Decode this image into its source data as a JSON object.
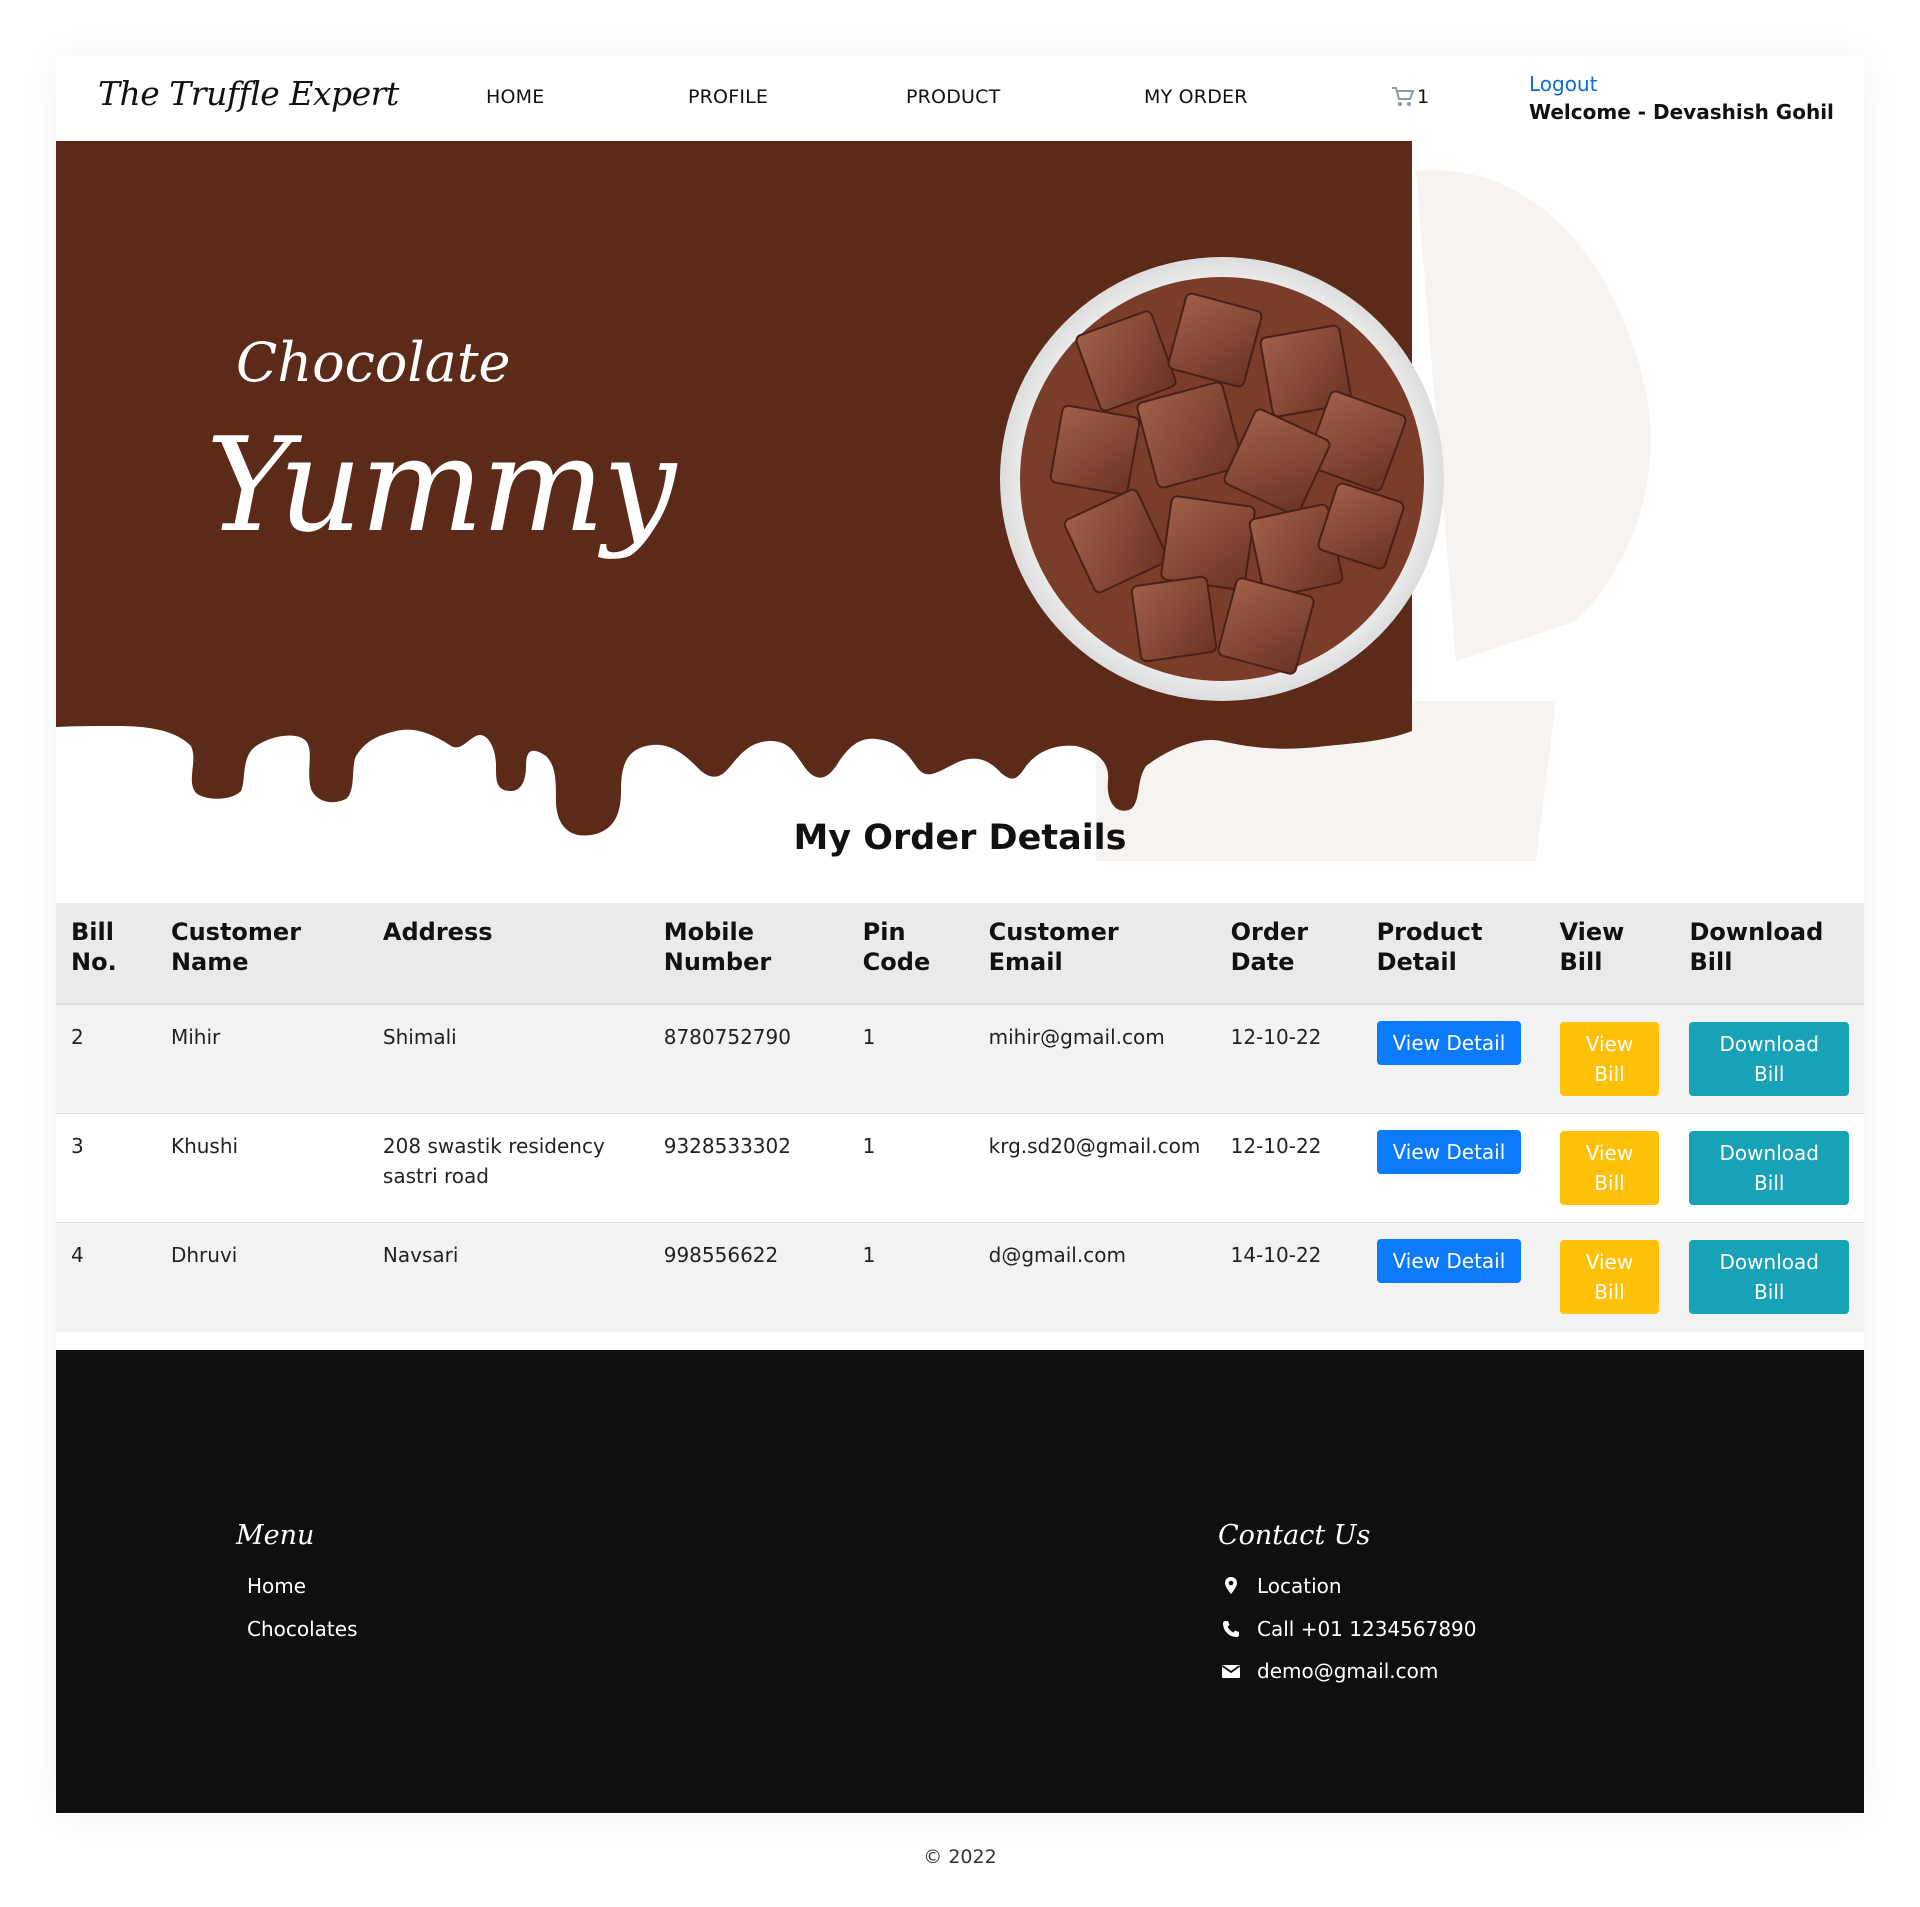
{
  "header": {
    "logo": "The Truffle Expert",
    "nav": [
      "HOME",
      "PROFILE",
      "PRODUCT",
      "MY ORDER"
    ],
    "cart_count": "1",
    "logout": "Logout",
    "welcome": "Welcome - Devashish Gohil"
  },
  "hero": {
    "subtitle": "Chocolate",
    "title": "Yummy"
  },
  "orders": {
    "title": "My Order Details",
    "columns": [
      "Bill No.",
      "Customer Name",
      "Address",
      "Mobile Number",
      "Pin Code",
      "Customer Email",
      "Order Date",
      "Product Detail",
      "View Bill",
      "Download Bill"
    ],
    "rows": [
      {
        "bill_no": "2",
        "name": "Mihir",
        "address": "Shimali",
        "mobile": "8780752790",
        "pin": "1",
        "email": "mihir@gmail.com",
        "date": "12-10-22"
      },
      {
        "bill_no": "3",
        "name": "Khushi",
        "address": "208 swastik residency sastri road",
        "mobile": "9328533302",
        "pin": "1",
        "email": "krg.sd20@gmail.com",
        "date": "12-10-22"
      },
      {
        "bill_no": "4",
        "name": "Dhruvi",
        "address": "Navsari",
        "mobile": "998556622",
        "pin": "1",
        "email": "d@gmail.com",
        "date": "14-10-22"
      }
    ],
    "buttons": {
      "view_detail": "View Detail",
      "view_bill": "View Bill",
      "download_bill": "Download Bill"
    }
  },
  "footer": {
    "menu_heading": "Menu",
    "menu_items": [
      "Home",
      "Chocolates"
    ],
    "contact_heading": "Contact Us",
    "location": "Location",
    "phone": "Call +01 1234567890",
    "email": "demo@gmail.com"
  },
  "copyright": "© 2022",
  "colors": {
    "chocolate": "#5c2a19",
    "primary": "#0b7bfc",
    "warning": "#ffc107",
    "info": "#17a2b8",
    "footer_bg": "#0f0f0f"
  }
}
